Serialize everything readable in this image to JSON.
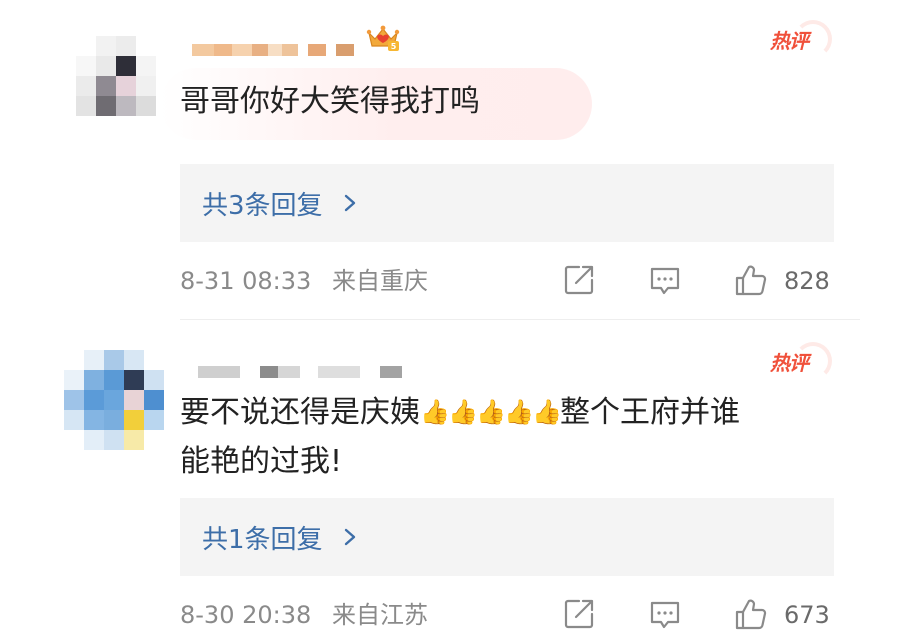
{
  "comments": [
    {
      "hot_tag": "热评",
      "text": "哥哥你好大笑得我打鸣",
      "reply_label": "共3条回复",
      "timestamp": "8-31 08:33",
      "location": "来自重庆",
      "likes": "828",
      "badge_icon": "crown-level-badge-icon"
    },
    {
      "hot_tag": "热评",
      "text_before": "要不说还得是庆姨",
      "thumbs_up_emoji": [
        "👍",
        "👍",
        "👍",
        "👍",
        "👍"
      ],
      "text_after": "整个王府并谁",
      "text_line2": "能艳的过我!",
      "reply_label": "共1条回复",
      "timestamp": "8-30 20:38",
      "location": "来自江苏",
      "likes": "673"
    }
  ],
  "colors": {
    "hot_tag": "#f0513b",
    "reply_link": "#3d6ea8",
    "reply_bg": "#f4f4f4",
    "meta_text": "#8a8a8a"
  }
}
